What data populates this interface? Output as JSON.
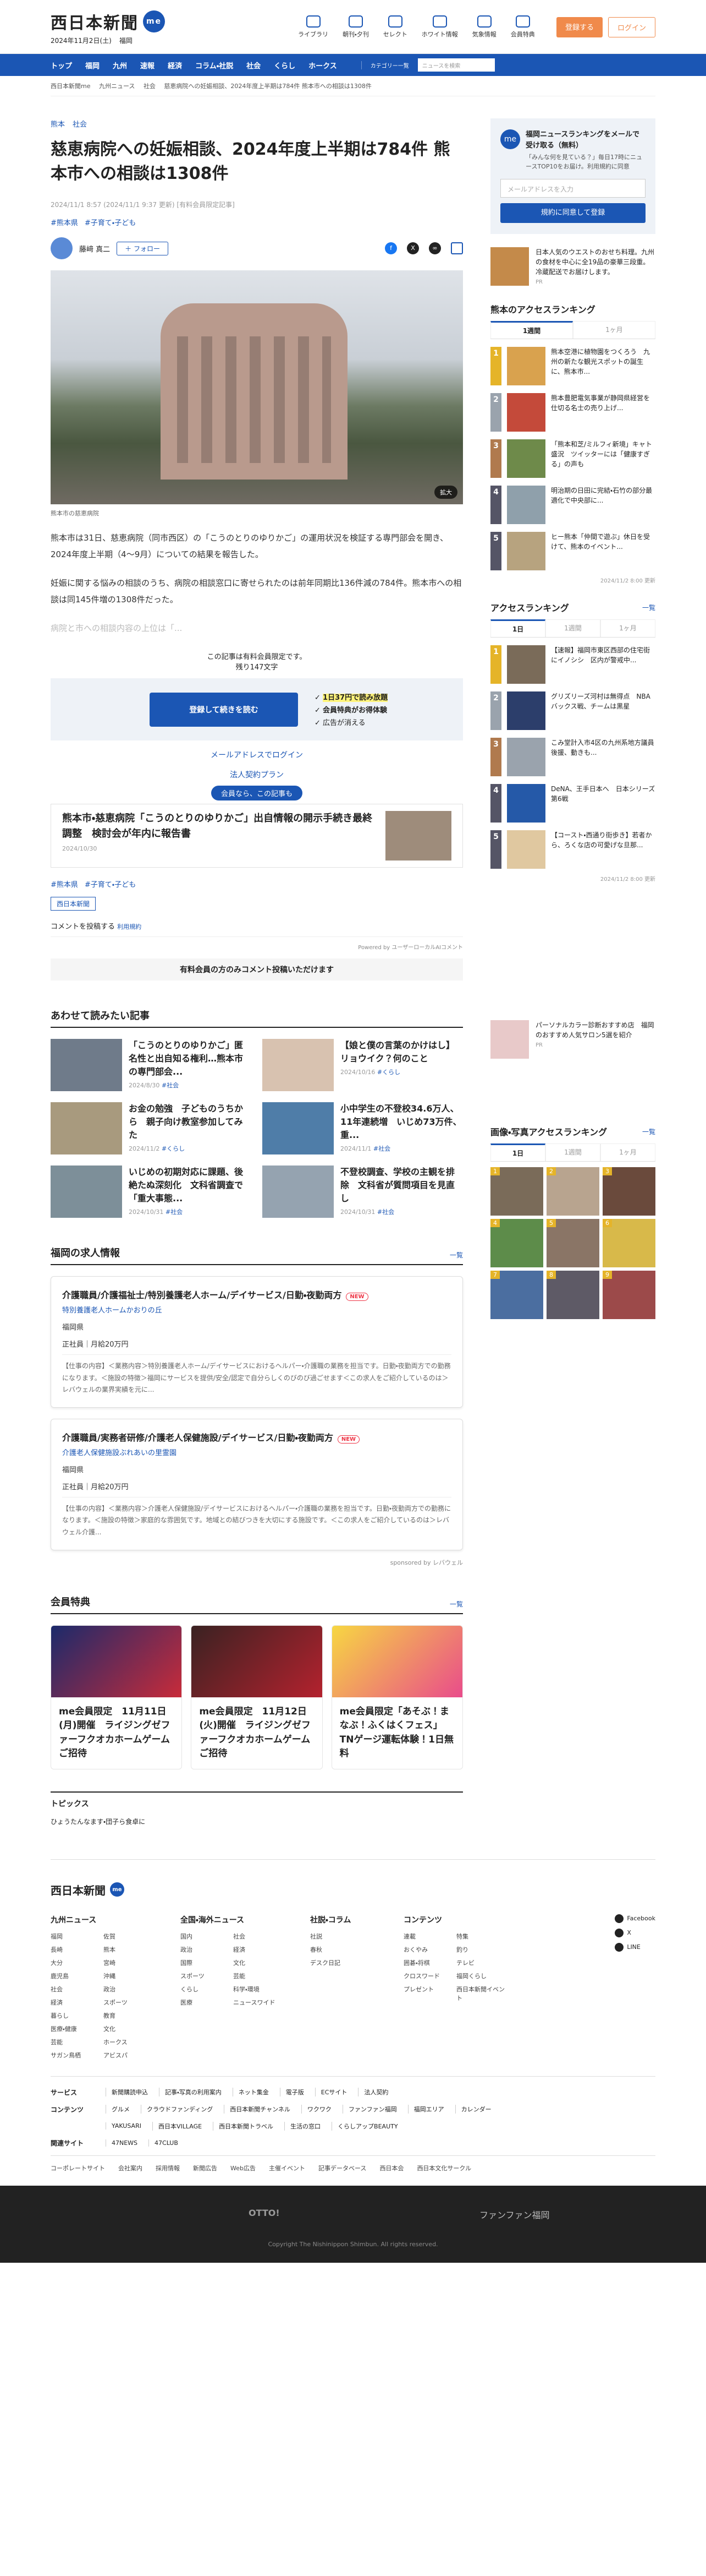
{
  "header": {
    "logo": "西日本新聞",
    "me": "me",
    "date": "2024年11月2日(土)",
    "weather_city": "福岡",
    "icons": [
      "ライブラリ",
      "朝刊・夕刊",
      "セレクト",
      "ホワイト情報",
      "気象情報",
      "会員特典"
    ],
    "login": "ログイン",
    "register": "登録する"
  },
  "nav": {
    "items": [
      "トップ",
      "福岡",
      "九州",
      "速報",
      "経済",
      "コラム・社説",
      "社会",
      "くらし",
      "ホークス"
    ],
    "menu": "カテゴリー一覧",
    "search_placeholder": "ニュースを検索"
  },
  "breadcrumb": [
    "西日本新聞me",
    "九州ニュース",
    "社会",
    "慈恵病院への妊娠相談、2024年度上半期は784件 熊本市への相談は1308件"
  ],
  "article": {
    "categories": [
      "熊本",
      "社会"
    ],
    "title": "慈恵病院への妊娠相談、2024年度上半期は784件 熊本市への相談は1308件",
    "meta": "2024/11/1 8:57 (2024/11/1 9:37 更新) [有料会員限定記事]",
    "tags": [
      "#熊本県",
      "#子育て・子ども"
    ],
    "author": "藤﨑 真二",
    "follow": "＋ フォロー",
    "zoom": "拡大",
    "caption": "熊本市の慈恵病院",
    "paragraphs": [
      "熊本市は31日、慈恵病院（同市西区）の「こうのとりのゆりかご」の運用状況を検証する専門部会を開き、2024年度上半期（4～9月）についての結果を報告した。",
      "妊娠に関する悩みの相談のうち、病院の相談窓口に寄せられたのは前年同期比136件減の784件。熊本市への相談は同145件増の1308件だった。",
      "病院と市への相談内容の上位は「..."
    ],
    "paywall_notice": "この記事は有料会員限定です。",
    "remaining": "残り147文字",
    "continue_btn": "登録して続きを読む",
    "benefits": [
      "1日37円で読み放題",
      "会員特典がお得体験",
      "広告が消える"
    ],
    "email_login": "メールアドレスでログイン",
    "corporate": "法人契約プラン",
    "related_badge": "会員なら、この記事も",
    "related_title": "熊本市・慈恵病院「こうのとりのゆりかご」出自情報の開示手続き最終調整　検討会が年内に報告書",
    "related_date": "2024/10/30",
    "bottom_tags": [
      "#熊本県",
      "#子育て・子ども"
    ],
    "paper_tag": "西日本新聞",
    "comment": "コメントを投稿する",
    "comment_link": "利用規約",
    "powered": "Powered by ユーザーローカルAIコメント",
    "comment_cta": "有料会員の方のみコメント投稿いただけます"
  },
  "read_together": {
    "title": "あわせて読みたい記事",
    "items": [
      {
        "title": "「こうのとりのゆりかご」匿名性と出自知る権利…熊本市の専門部会...",
        "date": "2024/8/30",
        "tag": "#社会"
      },
      {
        "title": "【娘と僕の言葉のかけはし】リョウイク？何のこと",
        "date": "2024/10/16",
        "tag": "#くらし"
      },
      {
        "title": "お金の勉強　子どものうちから　親子向け教室参加してみた",
        "date": "2024/11/2",
        "tag": "#くらし"
      },
      {
        "title": "小中学生の不登校34.6万人、11年連続増　いじめ73万件、重...",
        "date": "2024/11/1",
        "tag": "#社会"
      },
      {
        "title": "いじめの初期対応に課題、後絶たぬ深刻化　文科省調査で「重大事態...",
        "date": "2024/10/31",
        "tag": "#社会"
      },
      {
        "title": "不登校調査、学校の主観を排除　文科省が質問項目を見直し",
        "date": "2024/10/31",
        "tag": "#社会"
      }
    ]
  },
  "jobs": {
    "title": "福岡の求人情報",
    "more": "一覧",
    "items": [
      {
        "title": "介護職員/介護福祉士/特別養護老人ホーム/デイサービス/日勤・夜勤両方",
        "new": "NEW",
        "sub": "特別養護老人ホームかおりの丘",
        "loc": "福岡県",
        "pay": "正社員｜月給20万円",
        "desc": "【仕事の内容】＜業務内容＞特別養護老人ホーム/デイサービスにおけるヘルパー・介護職の業務を担当です。日勤・夜勤両方での勤務になります。＜施設の特徴＞福岡にサービスを提供/安全/認定で自分らしくのびのび過ごせます＜この求人をご紹介しているのは＞レバウェルの業界実績を元に..."
      },
      {
        "title": "介護職員/実務者研修/介護老人保健施設/デイサービス/日勤・夜勤両方",
        "new": "NEW",
        "sub": "介護老人保健施設ぶれあいの里霊園",
        "loc": "福岡県",
        "pay": "正社員｜月給20万円",
        "desc": "【仕事の内容】＜業務内容＞介護老人保健施設/デイサービスにおけるヘルパー・介護職の業務を担当です。日勤・夜勤両方での勤務になります。＜施設の特徴＞家庭的な雰囲気です。地域との結びつきを大切にする施設です。＜この求人をご紹介しているのは＞レバウェル介護..."
      }
    ],
    "sponsor": "sponsored by レバウェル"
  },
  "member": {
    "title": "会員特典",
    "more": "一覧",
    "items": [
      "me会員限定　11月11日(月)開催　ライジングゼファーフクオカホームゲームご招待",
      "me会員限定　11月12日(火)開催　ライジングゼファーフクオカホームゲームご招待",
      "me会員限定「あそぶ！まなぶ！ふくはくフェス」TNゲージ運転体験！1日無料"
    ]
  },
  "topics": {
    "title": "トピックス",
    "items": [
      "ひょうたんなます・団子ら食卓に"
    ]
  },
  "sidebar": {
    "nl_title": "福岡ニュースランキングをメールで受け取る（無料）",
    "nl_sub": "「みんな何を見ている？」毎日17時にニュースTOP10をお届け。利用規約に同意",
    "nl_placeholder": "メールアドレスを入力",
    "nl_btn": "規約に同意して登録",
    "pr_text": "日本人気のウエストのおせち料理。九州の食材を中心に全19品の豪華三段重。冷蔵配送でお届けします。",
    "pr_label": "PR",
    "kumamoto_title": "熊本のアクセスランキング",
    "kumamoto_tabs": [
      "1週間",
      "1ヶ月"
    ],
    "kumamoto": [
      "熊本空港に植物園をつくろう　九州の新たな観光スポットの誕生に、熊本市...",
      "熊本豊肥電気事業が静岡県経営を仕切る名士の売り上げ...",
      "「熊本和芝/ミルフィ新境」キャト盛況　ツイッターには「健康すぎる」の声も",
      "明治期の日田に完結・石竹の部分最適化で中央部に...",
      "ヒー熊本「仲間で遊ぶ」休日を受けて、熊本のイベント..."
    ],
    "kumamoto_date": "2024/11/2 8:00 更新",
    "access_title": "アクセスランキング",
    "access_more": "一覧",
    "access_tabs": [
      "1日",
      "1週間",
      "1ヶ月"
    ],
    "access": [
      "【速報】福岡市東区西部の住宅街にイノシシ　区内が警戒中...",
      "グリズリーズ河村は無得点　NBAバックス戦、チームは黒星",
      "こみ堂計入市4区の九州系地方議員後援、動きも...",
      "DeNA、王手日本へ　日本シリーズ第6戦",
      "【コースト・西通り街歩き】若者から、ろくな店の可愛げな旦那..."
    ],
    "access_date": "2024/11/2 8:00 更新",
    "pr2_text": "パーソナルカラー診断おすすめ店　福岡のおすすめ人気サロン5選を紹介",
    "photo_title": "画像・写真アクセスランキング",
    "photo_more": "一覧",
    "photo_tabs": [
      "1日",
      "1週間",
      "1ヶ月"
    ],
    "photo_nums": [
      "1",
      "2",
      "3",
      "4",
      "5",
      "6",
      "7",
      "8",
      "9"
    ]
  },
  "footer": {
    "logo": "西日本新聞",
    "cols": [
      {
        "h": "九州ニュース",
        "items": [
          "福岡",
          "佐賀",
          "長崎",
          "熊本",
          "大分",
          "宮崎",
          "鹿児島",
          "沖縄",
          "社会",
          "政治",
          "経済",
          "スポーツ",
          "暮らし",
          "教育",
          "医療・健康",
          "文化",
          "芸能",
          "ホークス",
          "サガン鳥栖",
          "アビスパ"
        ]
      },
      {
        "h": "全国・海外ニュース",
        "items": [
          "国内",
          "社会",
          "政治",
          "経済",
          "国際",
          "文化",
          "スポーツ",
          "芸能",
          "くらし",
          "科学・環境",
          "医療",
          "ニュースワイド"
        ]
      },
      {
        "h": "社説・コラム",
        "items": [
          "社説",
          "春秋",
          "デスク日記"
        ]
      },
      {
        "h": "コンテンツ",
        "items": [
          "連載",
          "特集",
          "おくやみ",
          "釣り",
          "囲碁・将棋",
          "テレビ",
          "クロスワード",
          "福岡くらし",
          "プレゼント",
          "西日本新聞イベント"
        ]
      }
    ],
    "social": [
      "Facebook",
      "X",
      "LINE"
    ],
    "rows": [
      {
        "h": "サービス",
        "items": [
          "新聞購読申込",
          "記事・写真の利用案内",
          "ネット集金",
          "電子版",
          "ECサイト",
          "法人契約"
        ]
      },
      {
        "h": "コンテンツ",
        "items": [
          "グルメ",
          "クラウドファンディング",
          "西日本新聞チャンネル",
          "ワクワク",
          "ファンファン福岡",
          "福岡エリア",
          "カレンダー"
        ]
      },
      {
        "h": "",
        "items": [
          "YAKUSARI",
          "西日本VILLAGE",
          "西日本新聞トラベル",
          "生活の窓口",
          "くらしアップBEAUTY"
        ]
      },
      {
        "h": "関連サイト",
        "items": [
          "47NEWS",
          "47CLUB"
        ]
      }
    ],
    "links": [
      "コーポレートサイト",
      "会社案内",
      "採用情報",
      "新聞広告",
      "Web広告",
      "主催イベント",
      "記事データベース",
      "西日本会",
      "西日本文化サークル"
    ],
    "otto": "OTTO!",
    "fan": "ファンファン福岡",
    "copyright": "Copyright The Nishinippon Shimbun. All rights reserved."
  }
}
